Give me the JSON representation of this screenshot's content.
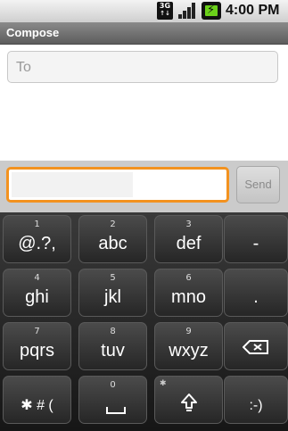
{
  "status_bar": {
    "network_type": "3G",
    "network_arrows": "↑↓",
    "time": "4:00 PM"
  },
  "title": "Compose",
  "to_field": {
    "placeholder": "To"
  },
  "send_label": "Send",
  "keyboard": {
    "rows": [
      [
        {
          "num": "1",
          "label": "@.?,"
        },
        {
          "num": "2",
          "label": "abc"
        },
        {
          "num": "3",
          "label": "def"
        },
        {
          "num": "",
          "label": "-"
        }
      ],
      [
        {
          "num": "4",
          "label": "ghi"
        },
        {
          "num": "5",
          "label": "jkl"
        },
        {
          "num": "6",
          "label": "mno"
        },
        {
          "num": "",
          "label": "."
        }
      ],
      [
        {
          "num": "7",
          "label": "pqrs"
        },
        {
          "num": "8",
          "label": "tuv"
        },
        {
          "num": "9",
          "label": "wxyz"
        }
      ],
      [
        {
          "num": "",
          "label": "✱ # ("
        },
        {
          "num": "0",
          "label": ""
        },
        {
          "num": "",
          "label": ""
        },
        {
          "num": "",
          "label": ":-)"
        }
      ]
    ],
    "shift_corner": "✱"
  }
}
